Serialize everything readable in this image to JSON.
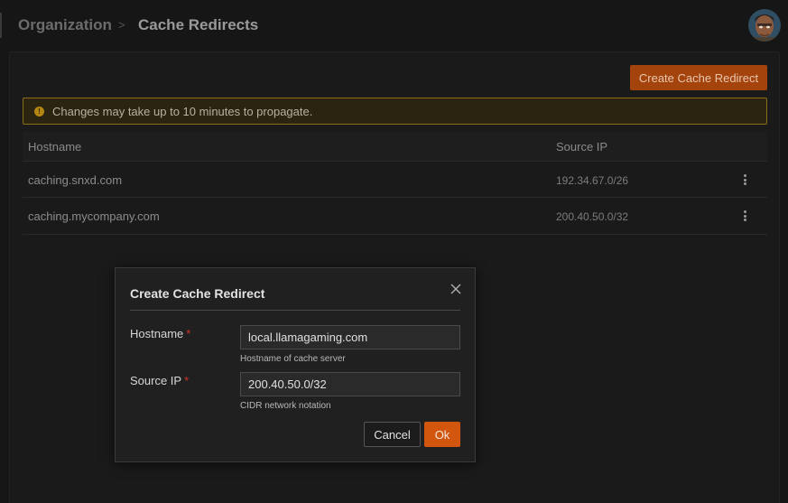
{
  "breadcrumb": {
    "root": "Organization",
    "separator": ">",
    "current": "Cache Redirects"
  },
  "avatar": {
    "icon": "user-avatar"
  },
  "toolbar": {
    "create_label": "Create Cache Redirect"
  },
  "alert": {
    "message": "Changes may take up to 10 minutes to propagate."
  },
  "table": {
    "columns": [
      "Hostname",
      "Source IP"
    ],
    "rows": [
      {
        "hostname": "caching.snxd.com",
        "source_ip": "192.34.67.0/26"
      },
      {
        "hostname": "caching.mycompany.com",
        "source_ip": "200.40.50.0/32"
      }
    ]
  },
  "modal": {
    "title": "Create Cache Redirect",
    "hostname": {
      "label": "Hostname",
      "required_mark": "*",
      "value": "local.llamagaming.com",
      "help": "Hostname of cache server"
    },
    "source_ip": {
      "label": "Source IP",
      "required_mark": "*",
      "value": "200.40.50.0/32",
      "help": "CIDR network notation"
    },
    "cancel_label": "Cancel",
    "ok_label": "Ok"
  },
  "colors": {
    "accent": "#d2560e",
    "warning_border": "#8a6d14",
    "required": "#d83030"
  }
}
